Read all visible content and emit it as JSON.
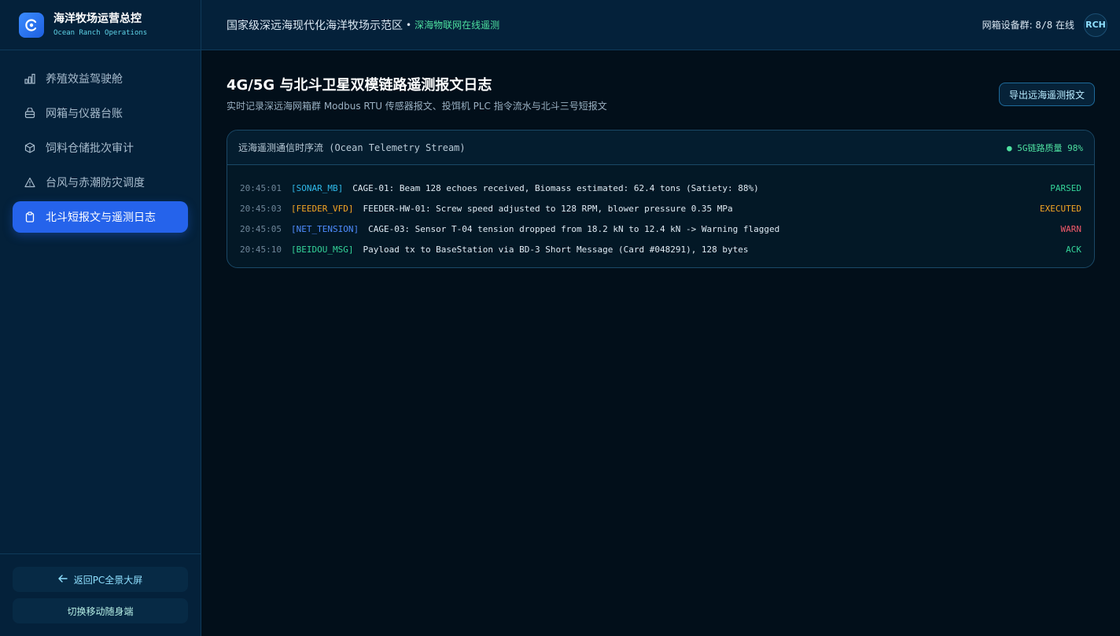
{
  "brand": {
    "title": "海洋牧场运营总控",
    "subtitle": "Ocean Ranch Operations"
  },
  "sidebar": {
    "items": [
      {
        "label": "养殖效益驾驶舱",
        "icon": "bar-chart-icon",
        "active": false
      },
      {
        "label": "网箱与仪器台账",
        "icon": "archive-icon",
        "active": false
      },
      {
        "label": "饲料仓储批次审计",
        "icon": "box-icon",
        "active": false
      },
      {
        "label": "台风与赤潮防灾调度",
        "icon": "warning-icon",
        "active": false
      },
      {
        "label": "北斗短报文与遥测日志",
        "icon": "clipboard-icon",
        "active": true
      }
    ],
    "back_button": "返回PC全景大屏",
    "mobile_button": "切换移动随身端"
  },
  "header": {
    "title": "国家级深远海现代化海洋牧场示范区",
    "separator": "•",
    "status": "深海物联网在线遥测",
    "device_label": "网箱设备群:",
    "device_count": "8/8",
    "device_suffix": "在线",
    "avatar": "RCH"
  },
  "page": {
    "title": "4G/5G 与北斗卫星双模链路遥测报文日志",
    "subtitle": "实时记录深远海网箱群 Modbus RTU 传感器报文、投饵机 PLC 指令流水与北斗三号短报文",
    "export_button": "导出远海遥测报文"
  },
  "stream": {
    "title": "远海遥测通信时序流 (Ocean Telemetry Stream)",
    "quality": "● 5G链路质量 98%",
    "logs": [
      {
        "time": "20:45:01",
        "tag": "[SONAR_MB]",
        "message": "CAGE-01: Beam 128 echoes received, Biomass estimated: 62.4 tons (Satiety: 88%)",
        "status": "PARSED"
      },
      {
        "time": "20:45:03",
        "tag": "[FEEDER_VFD]",
        "message": "FEEDER-HW-01: Screw speed adjusted to 128 RPM, blower pressure 0.35 MPa",
        "status": "EXECUTED"
      },
      {
        "time": "20:45:05",
        "tag": "[NET_TENSION]",
        "message": "CAGE-03: Sensor T-04 tension dropped from 18.2 kN to 12.4 kN -> Warning flagged",
        "status": "WARN"
      },
      {
        "time": "20:45:10",
        "tag": "[BEIDOU_MSG]",
        "message": "Payload tx to BaseStation via BD-3 Short Message (Card #048291), 128 bytes",
        "status": "ACK"
      }
    ]
  },
  "colors": {
    "tag_sonar": "#2fb8e8",
    "tag_feeder": "#f5a524",
    "tag_net": "#4f8cff",
    "tag_beidou": "#34d399",
    "status_parsed": "#34d399",
    "status_executed": "#f5a524",
    "status_warn": "#f25a6a",
    "status_ack": "#34d399",
    "accent": "#2563eb"
  }
}
